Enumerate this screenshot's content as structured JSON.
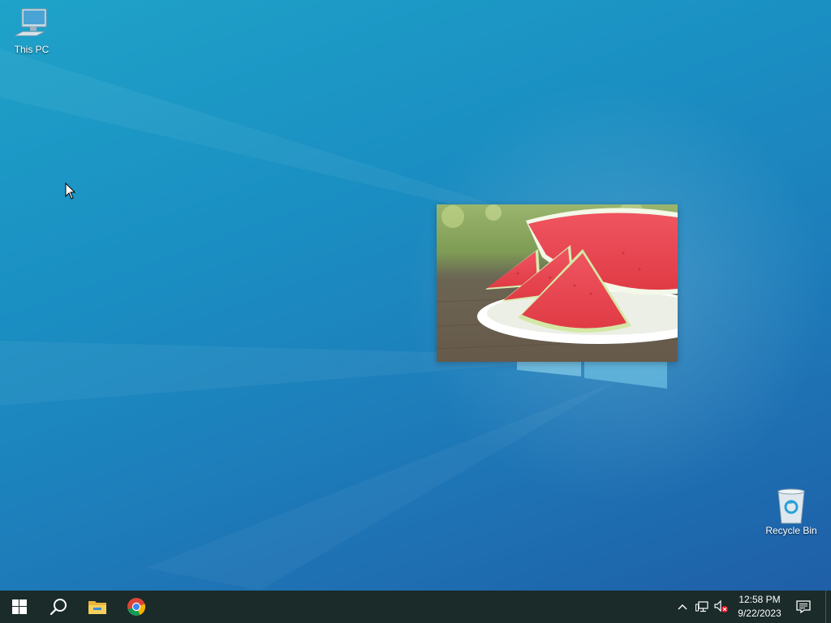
{
  "desktop": {
    "icons": [
      {
        "label": "This PC",
        "icon": "computer-icon"
      },
      {
        "label": "Recycle Bin",
        "icon": "recycle-bin-icon"
      }
    ],
    "photo": {
      "subject": "watermelon-slices-photo"
    }
  },
  "taskbar": {
    "buttons": [
      {
        "icon": "windows-start-icon"
      },
      {
        "icon": "search-icon"
      },
      {
        "icon": "file-explorer-icon"
      },
      {
        "icon": "chrome-icon"
      }
    ],
    "tray": {
      "icons": [
        "chevron-up-icon",
        "network-icon",
        "volume-muted-icon",
        "notification-icon"
      ],
      "time": "12:58 PM",
      "date": "9/22/2023"
    }
  },
  "colors": {
    "taskbar_bg": "#1a2b29",
    "desktop_accent": "#1a8fc2"
  }
}
